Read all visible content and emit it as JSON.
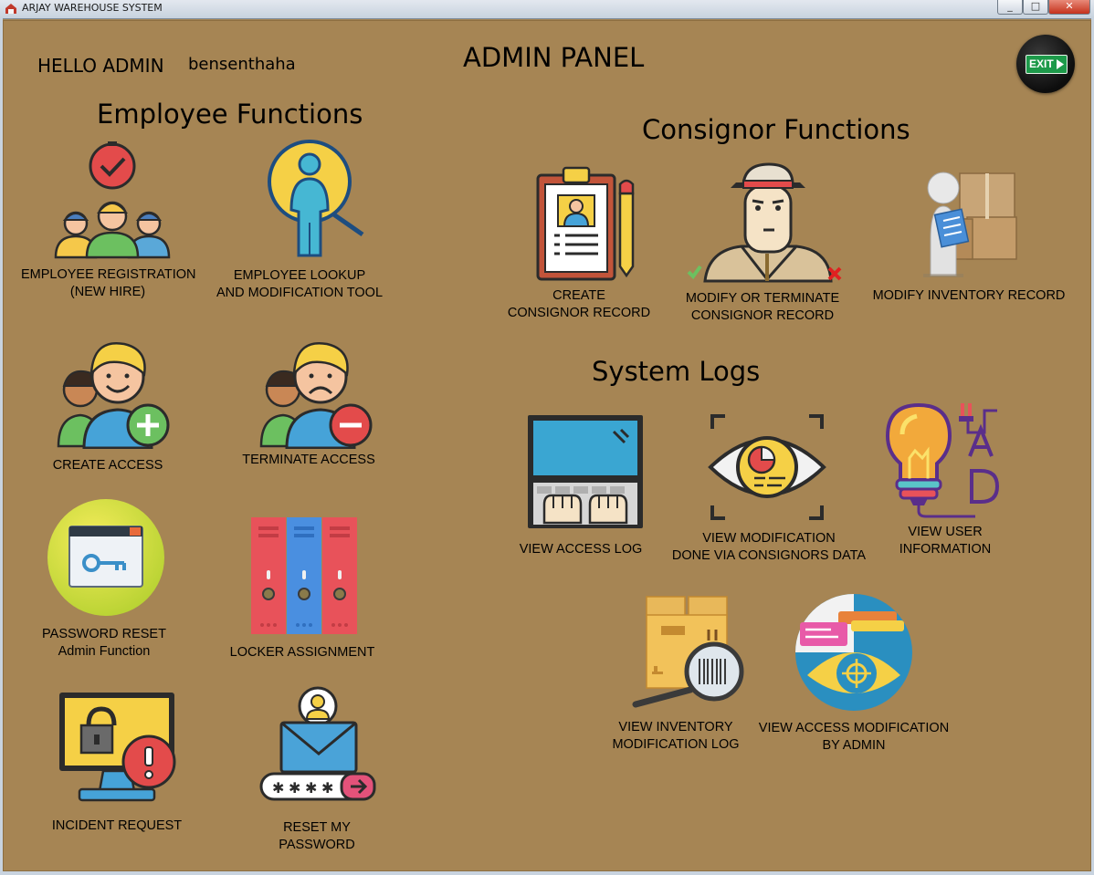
{
  "window": {
    "title": "ARJAY WAREHOUSE SYSTEM",
    "minimize_label": "_",
    "maximize_label": "□",
    "close_label": "✕"
  },
  "header": {
    "greeting": "HELLO ADMIN",
    "username": "bensenthaha",
    "panel_title": "ADMIN PANEL",
    "exit_label": "EXIT"
  },
  "employee": {
    "heading": "Employee Functions",
    "registration": {
      "line1": "EMPLOYEE REGISTRATION",
      "line2": "(NEW HIRE)"
    },
    "lookup": {
      "line1": "EMPLOYEE LOOKUP",
      "line2": "AND MODIFICATION TOOL"
    },
    "create_access": {
      "line1": "CREATE ACCESS"
    },
    "terminate_access": {
      "line1": "TERMINATE ACCESS"
    },
    "password_reset": {
      "line1": "PASSWORD RESET",
      "line2": "Admin Function"
    },
    "locker": {
      "line1": "LOCKER ASSIGNMENT"
    },
    "incident": {
      "line1": "INCIDENT REQUEST"
    },
    "reset_my_password": {
      "line1": "RESET MY",
      "line2": "PASSWORD"
    }
  },
  "consignor": {
    "heading": "Consignor Functions",
    "create": {
      "line1": "CREATE",
      "line2": "CONSIGNOR RECORD"
    },
    "modify": {
      "line1": "MODIFY OR TERMINATE",
      "line2": "CONSIGNOR RECORD"
    },
    "inventory": {
      "line1": "MODIFY INVENTORY RECORD"
    }
  },
  "logs": {
    "heading": "System Logs",
    "access_log": {
      "line1": "VIEW ACCESS LOG"
    },
    "modification": {
      "line1": "VIEW MODIFICATION",
      "line2": "DONE VIA CONSIGNORS DATA"
    },
    "user_info": {
      "line1": "VIEW USER",
      "line2": "INFORMATION"
    },
    "inventory_log": {
      "line1": "VIEW INVENTORY",
      "line2": "MODIFICATION LOG"
    },
    "access_mod": {
      "line1": "VIEW ACCESS MODIFICATION",
      "line2": "BY ADMIN"
    }
  },
  "colors": {
    "background": "#a68554",
    "exit_green": "#1d9a4a"
  },
  "icons": [
    "registration-team-icon",
    "magnifier-person-icon",
    "add-user-icon",
    "remove-user-icon",
    "password-key-icon",
    "lockers-icon",
    "monitor-alert-icon",
    "email-password-icon",
    "clipboard-profile-icon",
    "consignor-man-icon",
    "inventory-boxes-icon",
    "laptop-typing-icon",
    "eye-scan-icon",
    "lightbulb-ab-icon",
    "barcode-box-icon",
    "eye-target-icon"
  ]
}
